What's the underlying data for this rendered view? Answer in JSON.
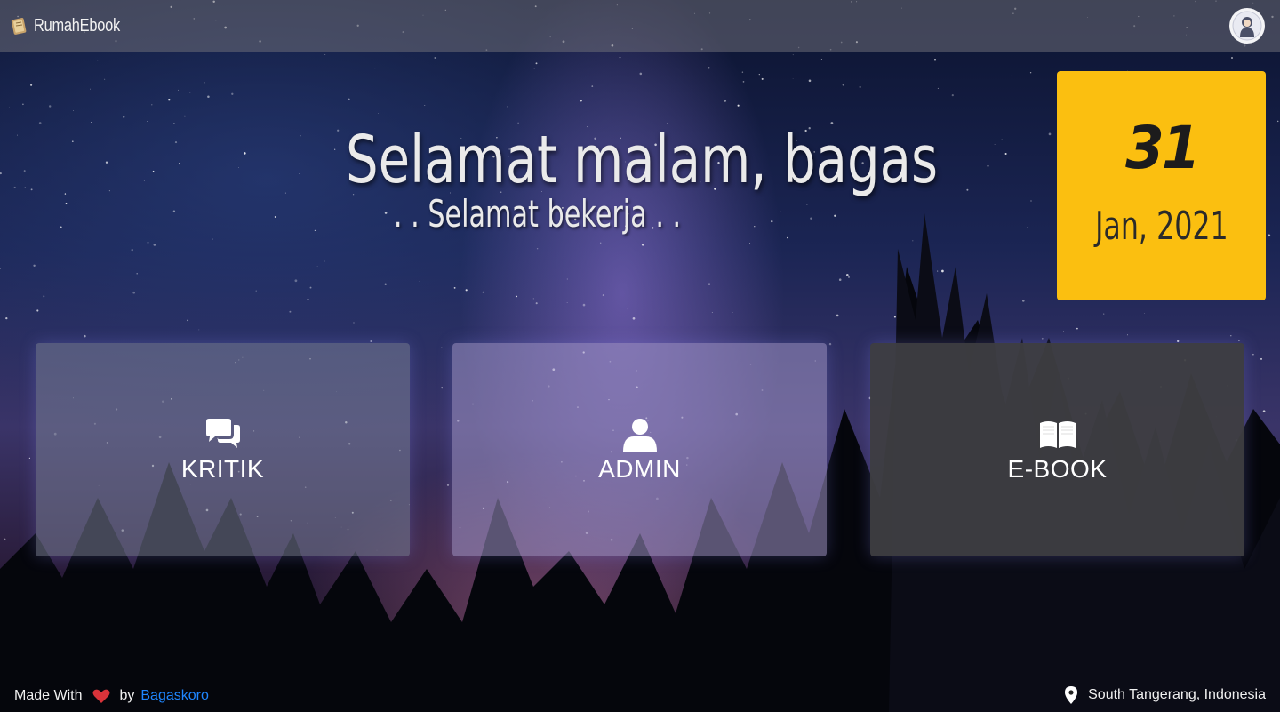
{
  "navbar": {
    "brand": "RumahEbook",
    "brand_icon": "book-scroll-icon",
    "avatar_icon": "user-avatar-icon"
  },
  "greeting": {
    "title": "Selamat malam, bagas",
    "subtitle": ". . Selamat bekerja . ."
  },
  "date": {
    "day": "31",
    "month_year": "Jan, 2021",
    "card_color": "#fbbf10"
  },
  "menu": [
    {
      "label": "KRITIK",
      "icon": "comments-icon"
    },
    {
      "label": "ADMIN",
      "icon": "user-icon"
    },
    {
      "label": "E-BOOK",
      "icon": "open-book-icon"
    }
  ],
  "footer": {
    "made_with": "Made With",
    "by": "by",
    "author": "Bagaskoro",
    "author_color": "#1f86ff",
    "heart_icon": "heart-icon",
    "location": "South Tangerang, Indonesia",
    "location_icon": "map-pin-icon"
  }
}
